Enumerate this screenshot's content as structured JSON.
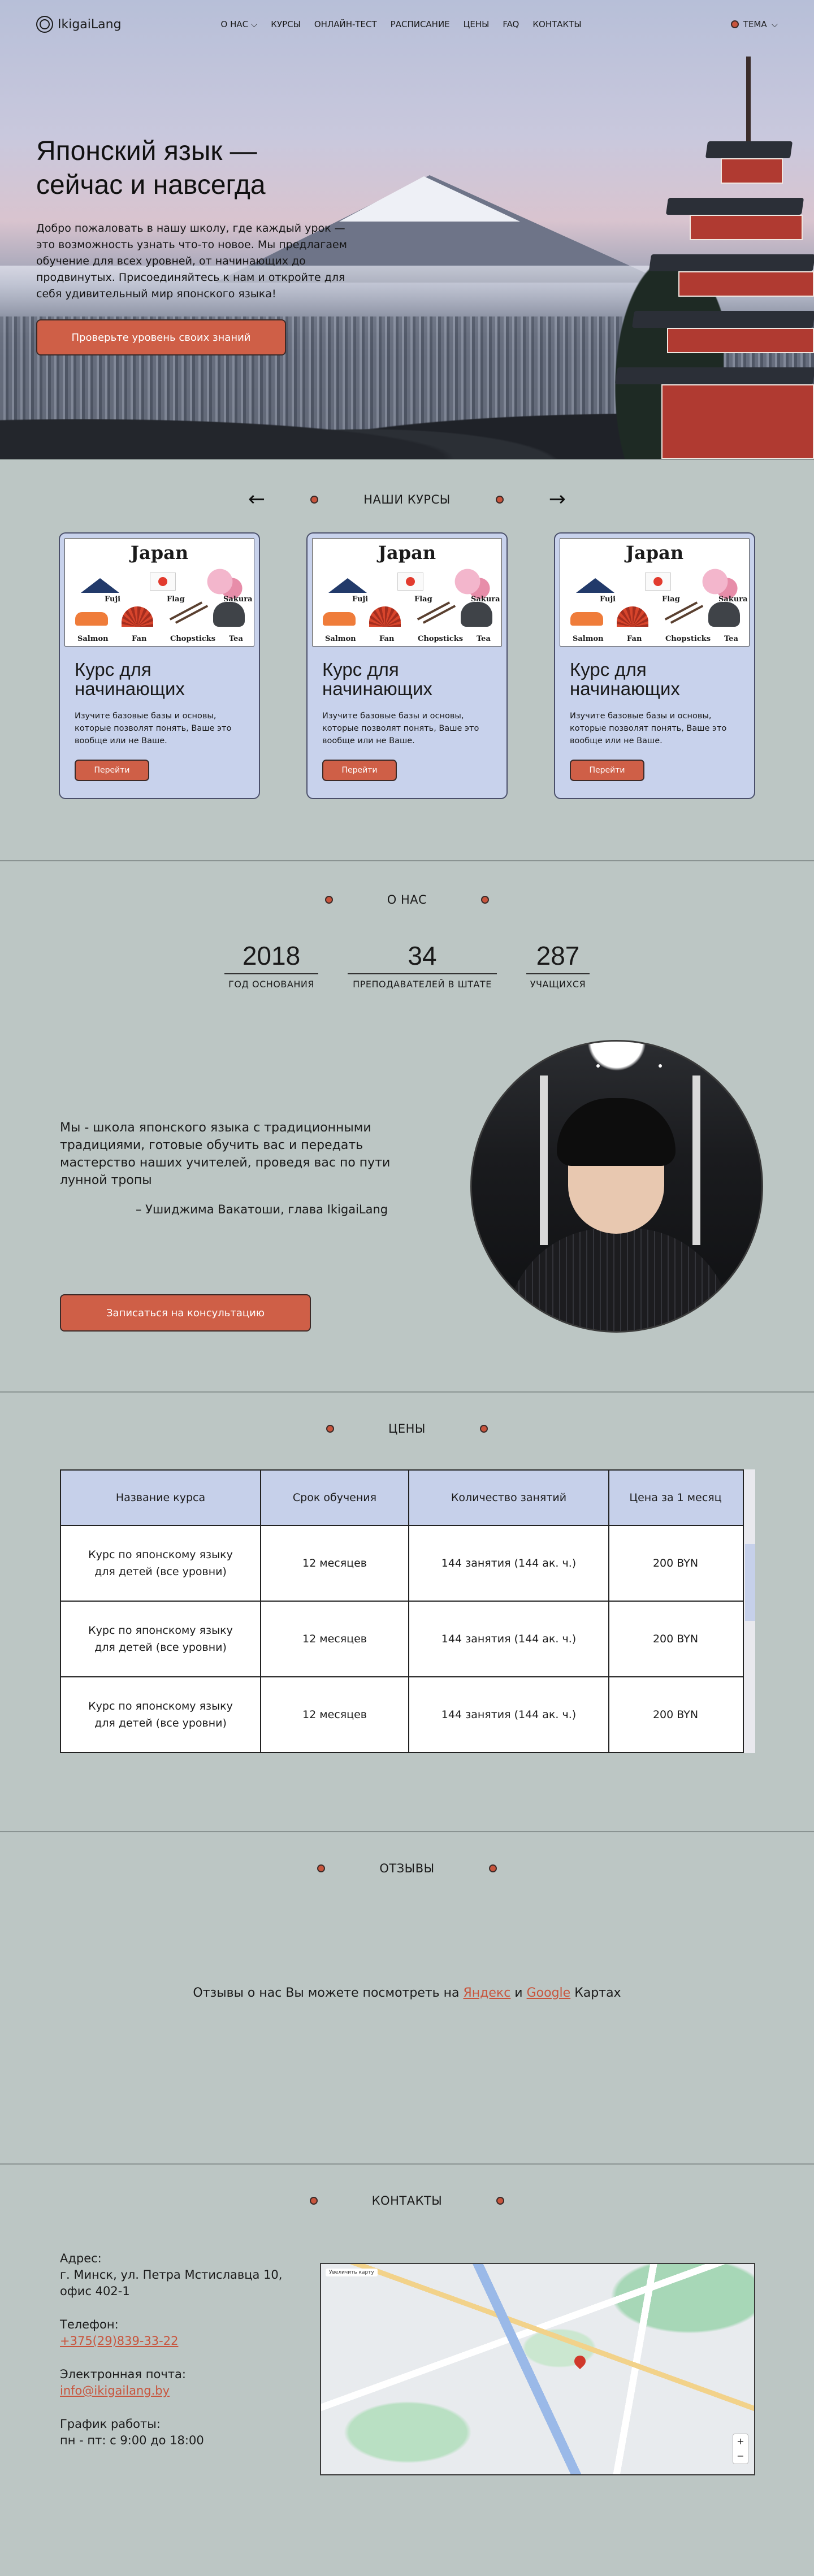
{
  "nav": {
    "logo": "IkigaiLang",
    "menu": [
      "О НАС",
      "КУРСЫ",
      "ОНЛАЙН-ТЕСТ",
      "РАСПИСАНИЕ",
      "ЦЕНЫ",
      "FAQ",
      "КОНТАКТЫ"
    ],
    "theme_label": "ТЕМА"
  },
  "hero": {
    "title_line1": "Японский язык —",
    "title_line2": "сейчас и навсегда",
    "text": "Добро пожаловать в нашу школу, где каждый урок — это возможность узнать что-то новое. Мы предлагаем обучение для всех уровней, от начинающих до продвинутых. Присоединяйтесь к нам и откройте для себя удивительный мир японского языка!",
    "button": "Проверьте уровень своих знаний"
  },
  "courses": {
    "title": "НАШИ КУРСЫ",
    "prev_icon": "arrow-left-icon",
    "next_icon": "arrow-right-icon",
    "image": {
      "title": "Japan",
      "labels": [
        "Fuji",
        "Flag",
        "Sakura",
        "Salmon",
        "Fan",
        "Chopsticks",
        "Tea"
      ]
    },
    "cards": [
      {
        "title": "Курс для начинающих",
        "text": "Изучите базовые базы и основы, которые позволят понять, Ваше это вообще или не Ваше.",
        "button": "Перейти"
      },
      {
        "title": "Курс для начинающих",
        "text": "Изучите базовые базы и основы, которые позволят понять, Ваше это вообще или не Ваше.",
        "button": "Перейти"
      },
      {
        "title": "Курс для начинающих",
        "text": "Изучите базовые базы и основы, которые позволят понять, Ваше это вообще или не Ваше.",
        "button": "Перейти"
      }
    ]
  },
  "about": {
    "title": "О НАС",
    "stats": [
      {
        "value": "2018",
        "label": "ГОД ОСНОВАНИЯ"
      },
      {
        "value": "34",
        "label": "ПРЕПОДАВАТЕЛЕЙ В ШТАТЕ"
      },
      {
        "value": "287",
        "label": "УЧАЩИХСЯ"
      }
    ],
    "quote": "Мы - школа японского языка с традиционными традициями, готовые обучить вас и передать мастерство наших учителей, проведя вас по пути лунной тропы",
    "author": "– Ушиджима Вакатоши, глава IkigaiLang",
    "button": "Записаться на консультацию"
  },
  "prices": {
    "title": "ЦЕНЫ",
    "headers": [
      "Название курса",
      "Срок обучения",
      "Количество занятий",
      "Цена за 1 месяц"
    ],
    "rows": [
      [
        "Курс по японскому языку для детей (все уровни)",
        "12 месяцев",
        "144 занятия (144 ак. ч.)",
        "200 BYN"
      ],
      [
        "Курс по японскому языку для детей (все уровни)",
        "12 месяцев",
        "144 занятия (144 ак. ч.)",
        "200 BYN"
      ],
      [
        "Курс по японскому языку для детей (все уровни)",
        "12 месяцев",
        "144 занятия (144 ак. ч.)",
        "200 BYN"
      ]
    ]
  },
  "reviews": {
    "title": "ОТЗЫВЫ",
    "text_before": "Отзывы о нас Вы можете посмотреть на ",
    "link1": "Яндекс",
    "text_mid": " и ",
    "link2": "Google",
    "text_after": " Картах"
  },
  "contacts": {
    "title": "КОНТАКТЫ",
    "address_label": "Адрес:",
    "address": "г. Минск, ул. Петра Мстиславца 10, офис 402-1",
    "phone_label": "Телефон:",
    "phone": "+375(29)839-33-22",
    "email_label": "Электронная почта:",
    "email": "info@ikigailang.by",
    "hours_label": "График работы:",
    "hours": "пн - пт: с 9:00 до 18:00",
    "map_badge": "Увеличить карту"
  },
  "colors": {
    "accent": "#cf5f47",
    "card_bg": "#c8d2ec",
    "page_bg": "#bcc6c4"
  }
}
